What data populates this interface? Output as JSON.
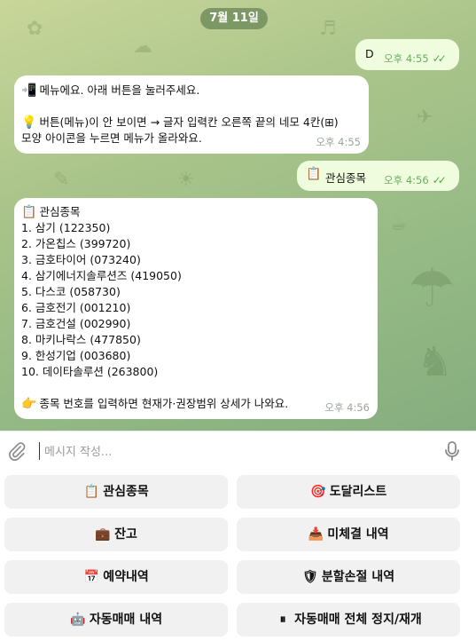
{
  "date_label": "7월 11일",
  "messages": {
    "m1": {
      "text": "D",
      "time": "오후 4:55"
    },
    "m2": {
      "line1": "메뉴에요. 아래 버튼을 눌러주세요.",
      "line2": "버튼(메뉴)이 안 보이면 → 글자 입력칸 오른쪽 끝의 네모 4칸(⊞)",
      "line3": "모양 아이콘을 누르면 메뉴가 올라와요.",
      "time": "오후 4:55"
    },
    "m3": {
      "text": "관심종목",
      "time": "오후 4:56"
    },
    "m4": {
      "title": "관심종목",
      "items": [
        "1. 삼기 (122350)",
        "2. 가온칩스 (399720)",
        "3. 금호타이어 (073240)",
        "4. 삼기에너지솔루션즈 (419050)",
        "5. 다스코 (058730)",
        "6. 금호전기 (001210)",
        "7. 금호건설 (002990)",
        "8. 마키나락스 (477850)",
        "9. 한성기업 (003680)",
        "10. 데이타솔루션 (263800)"
      ],
      "footer": "종목 번호를 입력하면 현재가·권장범위 상세가 나와요.",
      "time": "오후 4:56"
    }
  },
  "input": {
    "placeholder": "메시지 작성..."
  },
  "keyboard": {
    "b1": "관심종목",
    "b2": "도달리스트",
    "b3": "잔고",
    "b4": "미체결 내역",
    "b5": "예약내역",
    "b6": "분할손절 내역",
    "b7": "자동매매 내역",
    "b8": "자동매매 전체 정지/재개"
  }
}
